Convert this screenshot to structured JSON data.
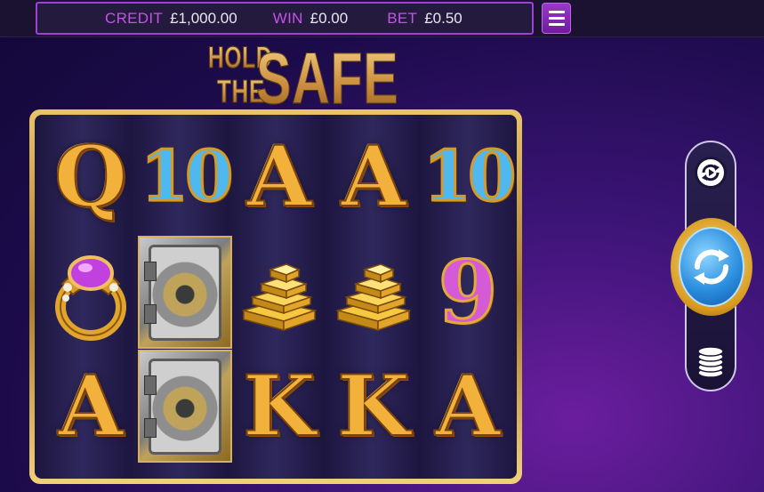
{
  "info_bar": {
    "credit_label": "CREDIT",
    "credit_value": "£1,000.00",
    "win_label": "WIN",
    "win_value": "£0.00",
    "bet_label": "BET",
    "bet_value": "£0.50"
  },
  "menu": {
    "icon": "hamburger-menu-icon"
  },
  "logo": {
    "line1": "HOLD",
    "line2": "THE",
    "line3": "SAFE"
  },
  "reels": {
    "rows": [
      [
        "Q",
        "10",
        "A",
        "A",
        "10"
      ],
      [
        "ring",
        "safe",
        "gold-bars",
        "gold-bars",
        "9"
      ],
      [
        "A",
        "safe",
        "K",
        "K",
        "A"
      ]
    ]
  },
  "controls": {
    "autoplay_icon": "autoplay-icon",
    "spin_icon": "spin-arrows-icon",
    "stake_icon": "coin-stack-icon"
  },
  "colors": {
    "accent": "#a13fd6",
    "label": "#c652e8",
    "gold": "#f2b13a",
    "spin_blue": "#2c8fe0"
  }
}
